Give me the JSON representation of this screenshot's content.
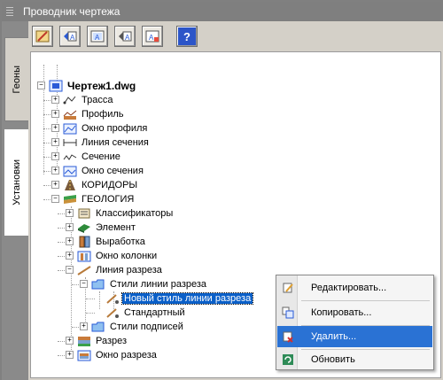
{
  "window": {
    "title": "Проводник чертежа"
  },
  "side_tabs": [
    "Геоны",
    "Установки"
  ],
  "toolbar": {
    "help_label": "?"
  },
  "tree": [
    {
      "id": "drawing",
      "label": "Чертеж1.dwg"
    },
    {
      "id": "trassa",
      "label": "Трасса"
    },
    {
      "id": "profil",
      "label": "Профиль"
    },
    {
      "id": "okno-profilya",
      "label": "Окно профиля"
    },
    {
      "id": "liniya-secheniya",
      "label": "Линия сечения"
    },
    {
      "id": "sechenie",
      "label": "Сечение"
    },
    {
      "id": "okno-secheniya",
      "label": "Окно сечения"
    },
    {
      "id": "koridory",
      "label": "КОРИДОРЫ"
    },
    {
      "id": "geologiya",
      "label": "ГЕОЛОГИЯ"
    },
    {
      "id": "klassifikatory",
      "label": "Классификаторы"
    },
    {
      "id": "element",
      "label": "Элемент"
    },
    {
      "id": "vyrabotka",
      "label": "Выработка"
    },
    {
      "id": "okno-kolonki",
      "label": "Окно колонки"
    },
    {
      "id": "liniya-razreza",
      "label": "Линия разреза"
    },
    {
      "id": "stili-linii-razreza",
      "label": "Стили линии разреза"
    },
    {
      "id": "novyj-stil",
      "label": "Новый стиль линии разреза"
    },
    {
      "id": "standartnyj",
      "label": "Стандартный"
    },
    {
      "id": "stili-podpisej",
      "label": "Стили подписей"
    },
    {
      "id": "razrez",
      "label": "Разрез"
    },
    {
      "id": "okno-razreza",
      "label": "Окно разреза"
    }
  ],
  "context_menu": [
    {
      "label": "Редактировать...",
      "icon": "edit-icon"
    },
    {
      "label": "Копировать...",
      "icon": "copy-icon"
    },
    {
      "label": "Удалить...",
      "icon": "delete-icon",
      "highlighted": true
    },
    {
      "label": "Обновить",
      "icon": "refresh-icon"
    }
  ],
  "colors": {
    "selection": "#0a5fc8",
    "menu_highlight": "#2a72d4",
    "panel": "#d4d0c8"
  }
}
